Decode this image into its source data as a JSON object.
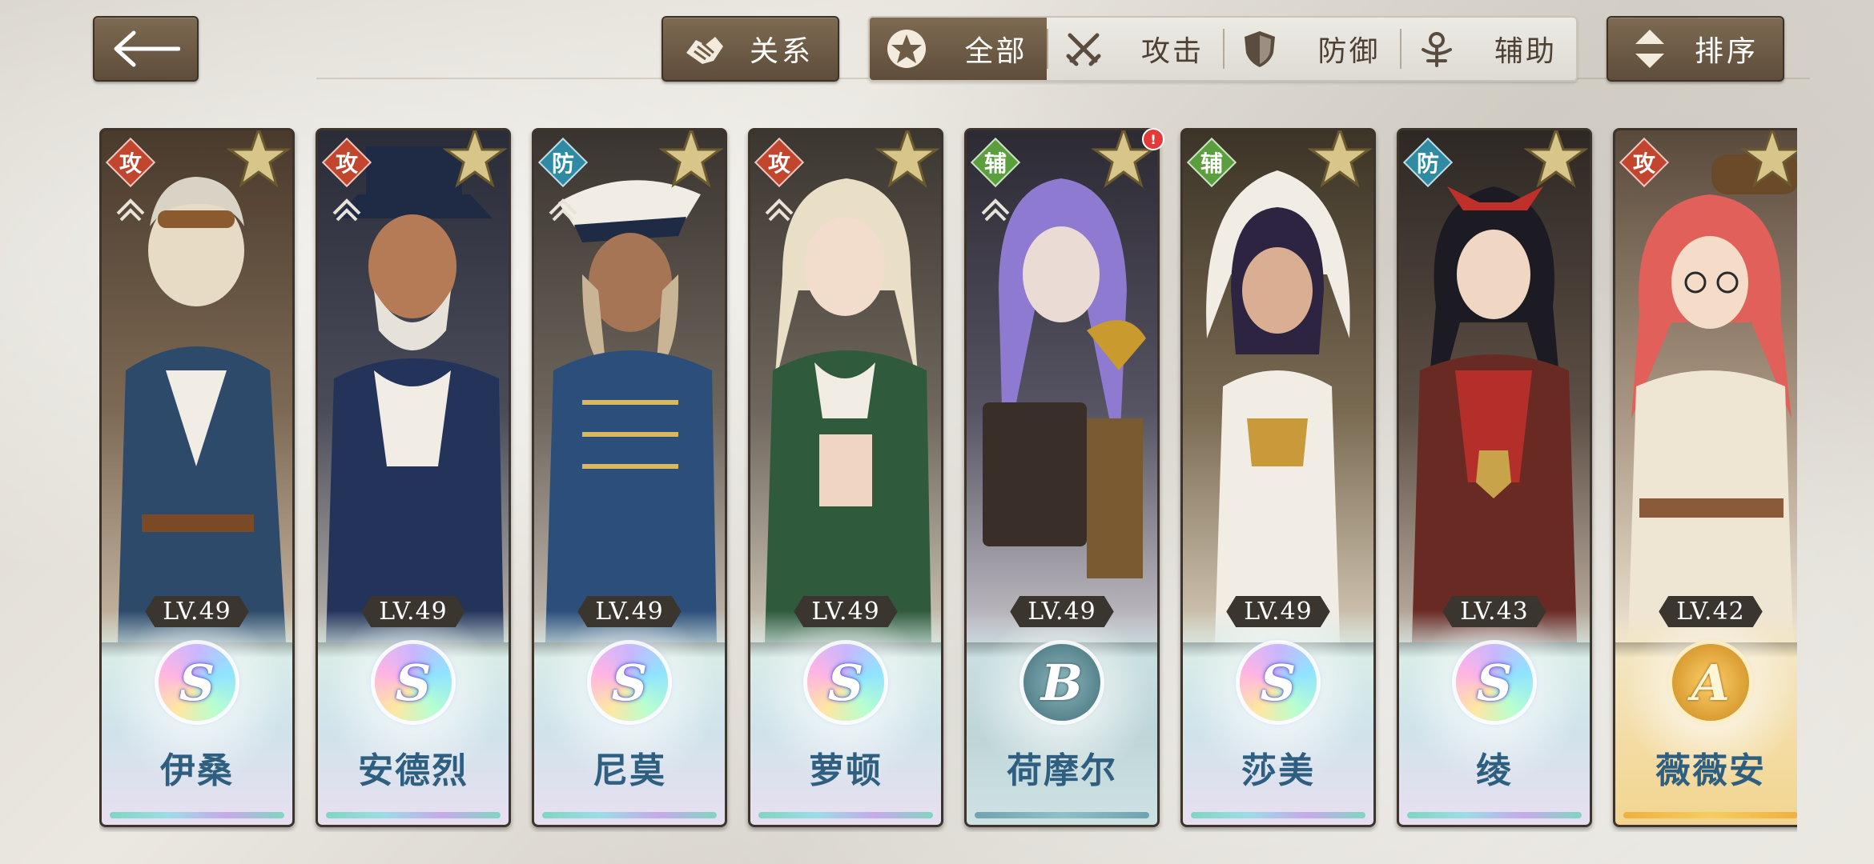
{
  "topbar": {
    "relation_label": "关系",
    "sort_label": "排序",
    "filters": [
      {
        "label": "全部",
        "icon": "star-emblem-icon",
        "active": true
      },
      {
        "label": "攻击",
        "icon": "crossed-swords-icon",
        "active": false
      },
      {
        "label": "防御",
        "icon": "shield-icon",
        "active": false
      },
      {
        "label": "辅助",
        "icon": "support-emblem-icon",
        "active": false
      }
    ]
  },
  "characters": [
    {
      "name": "伊桑",
      "level": "LV.49",
      "rank": "S",
      "role": "攻",
      "role_type": "attack"
    },
    {
      "name": "安德烈",
      "level": "LV.49",
      "rank": "S",
      "role": "攻",
      "role_type": "attack"
    },
    {
      "name": "尼莫",
      "level": "LV.49",
      "rank": "S",
      "role": "防",
      "role_type": "defense"
    },
    {
      "name": "萝顿",
      "level": "LV.49",
      "rank": "S",
      "role": "攻",
      "role_type": "attack"
    },
    {
      "name": "荷摩尔",
      "level": "LV.49",
      "rank": "B",
      "role": "辅",
      "role_type": "support",
      "notification": "!"
    },
    {
      "name": "莎美",
      "level": "LV.49",
      "rank": "S",
      "role": "辅",
      "role_type": "support"
    },
    {
      "name": "绫",
      "level": "LV.43",
      "rank": "S",
      "role": "防",
      "role_type": "defense"
    },
    {
      "name": "薇薇安",
      "level": "LV.42",
      "rank": "A",
      "role": "攻",
      "role_type": "attack"
    }
  ],
  "colors": {
    "button_dark": "#6e5c47",
    "attack": "#c2452d",
    "defense": "#2f8aa3",
    "support": "#5a9e3e",
    "name_text": "#2f5f80",
    "notification": "#e23a3a"
  }
}
